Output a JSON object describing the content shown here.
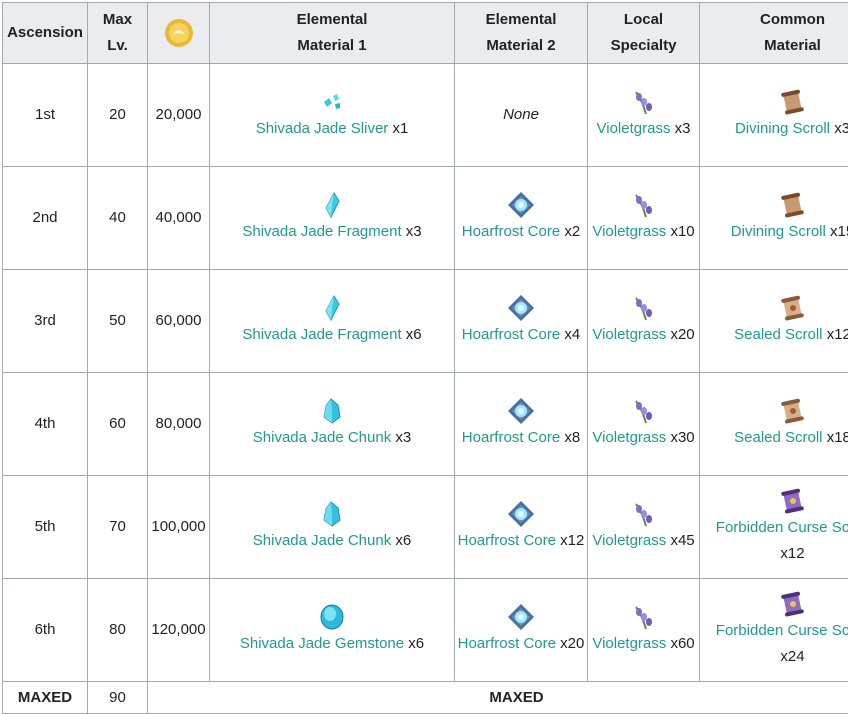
{
  "headers": {
    "ascension": "Ascension",
    "max_lv_1": "Max",
    "max_lv_2": "Lv.",
    "mora_icon": "mora-coin-icon",
    "elem1_1": "Elemental",
    "elem1_2": "Material 1",
    "elem2_1": "Elemental",
    "elem2_2": "Material 2",
    "local_1": "Local",
    "local_2": "Specialty",
    "common_1": "Common",
    "common_2": "Material"
  },
  "rows": [
    {
      "ascension": "1st",
      "max_lv": "20",
      "mora": "20,000",
      "elem1": {
        "icon": "jade-sliver-icon",
        "name": "Shivada Jade Sliver",
        "qty": "x1"
      },
      "elem2": {
        "none": "None"
      },
      "local": {
        "icon": "violetgrass-icon",
        "name": "Violetgrass",
        "qty": "x3"
      },
      "common": {
        "icon": "divining-scroll-icon",
        "name": "Divining Scroll",
        "qty": "x3"
      }
    },
    {
      "ascension": "2nd",
      "max_lv": "40",
      "mora": "40,000",
      "elem1": {
        "icon": "jade-fragment-icon",
        "name": "Shivada Jade Fragment",
        "qty": "x3"
      },
      "elem2": {
        "icon": "hoarfrost-core-icon",
        "name": "Hoarfrost Core",
        "qty": "x2"
      },
      "local": {
        "icon": "violetgrass-icon",
        "name": "Violetgrass",
        "qty": "x10"
      },
      "common": {
        "icon": "divining-scroll-icon",
        "name": "Divining Scroll",
        "qty": "x15"
      }
    },
    {
      "ascension": "3rd",
      "max_lv": "50",
      "mora": "60,000",
      "elem1": {
        "icon": "jade-fragment-icon",
        "name": "Shivada Jade Fragment",
        "qty": "x6"
      },
      "elem2": {
        "icon": "hoarfrost-core-icon",
        "name": "Hoarfrost Core",
        "qty": "x4"
      },
      "local": {
        "icon": "violetgrass-icon",
        "name": "Violetgrass",
        "qty": "x20"
      },
      "common": {
        "icon": "sealed-scroll-icon",
        "name": "Sealed Scroll",
        "qty": "x12"
      }
    },
    {
      "ascension": "4th",
      "max_lv": "60",
      "mora": "80,000",
      "elem1": {
        "icon": "jade-chunk-icon",
        "name": "Shivada Jade Chunk",
        "qty": "x3"
      },
      "elem2": {
        "icon": "hoarfrost-core-icon",
        "name": "Hoarfrost Core",
        "qty": "x8"
      },
      "local": {
        "icon": "violetgrass-icon",
        "name": "Violetgrass",
        "qty": "x30"
      },
      "common": {
        "icon": "sealed-scroll-icon",
        "name": "Sealed Scroll",
        "qty": "x18"
      }
    },
    {
      "ascension": "5th",
      "max_lv": "70",
      "mora": "100,000",
      "elem1": {
        "icon": "jade-chunk-icon",
        "name": "Shivada Jade Chunk",
        "qty": "x6"
      },
      "elem2": {
        "icon": "hoarfrost-core-icon",
        "name": "Hoarfrost Core",
        "qty": "x12"
      },
      "local": {
        "icon": "violetgrass-icon",
        "name": "Violetgrass",
        "qty": "x45"
      },
      "common": {
        "icon": "forbidden-curse-scroll-icon",
        "name": "Forbidden Curse Scroll",
        "qty": "x12"
      }
    },
    {
      "ascension": "6th",
      "max_lv": "80",
      "mora": "120,000",
      "elem1": {
        "icon": "jade-gemstone-icon",
        "name": "Shivada Jade Gemstone",
        "qty": "x6"
      },
      "elem2": {
        "icon": "hoarfrost-core-icon",
        "name": "Hoarfrost Core",
        "qty": "x20"
      },
      "local": {
        "icon": "violetgrass-icon",
        "name": "Violetgrass",
        "qty": "x60"
      },
      "common": {
        "icon": "forbidden-curse-scroll-icon",
        "name": "Forbidden Curse Scroll",
        "qty": "x24"
      }
    }
  ],
  "maxed": {
    "ascension": "MAXED",
    "max_lv": "90",
    "label": "MAXED"
  },
  "colors": {
    "link": "#1f9a8e",
    "header_bg": "#eaecf0",
    "border": "#a2a9b1"
  }
}
